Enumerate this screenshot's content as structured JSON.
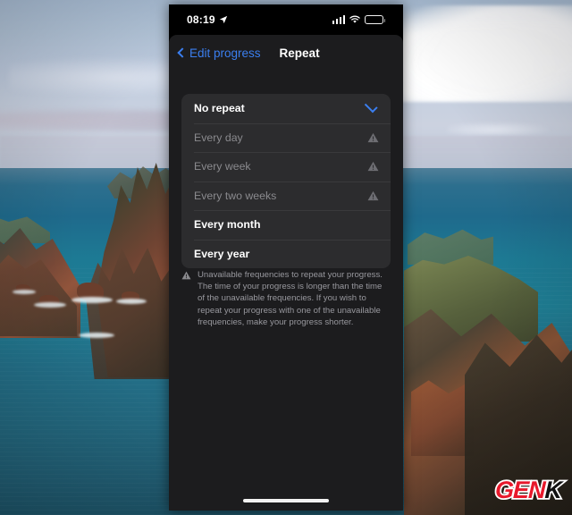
{
  "background": {
    "description": "coastal cliffs and ocean landscape photo",
    "sky_color": "#bdcade",
    "sea_color": "#1f7f95",
    "cliff_color": "#8b4f38"
  },
  "watermark": {
    "part1": "GEN",
    "part2": "K",
    "color1": "#e8192c",
    "color2": "#111111"
  },
  "phone": {
    "status_bar": {
      "time": "08:19",
      "location_icon": "location-arrow-icon",
      "cellular_icon": "signal-bars-icon",
      "wifi_icon": "wifi-icon",
      "battery_icon": "battery-icon"
    },
    "nav_bar": {
      "back_label": "Edit progress",
      "back_icon": "chevron-left-icon",
      "title": "Repeat"
    },
    "options": [
      {
        "label": "No repeat",
        "state": "selected",
        "accessory": "checkmark-icon"
      },
      {
        "label": "Every day",
        "state": "disabled",
        "accessory": "warning-triangle-icon"
      },
      {
        "label": "Every week",
        "state": "disabled",
        "accessory": "warning-triangle-icon"
      },
      {
        "label": "Every two weeks",
        "state": "disabled",
        "accessory": "warning-triangle-icon"
      },
      {
        "label": "Every month",
        "state": "enabled",
        "accessory": "none"
      },
      {
        "label": "Every year",
        "state": "enabled",
        "accessory": "none"
      }
    ],
    "footer_note": {
      "icon": "warning-triangle-icon",
      "text": "Unavailable frequencies to repeat your progress. The time of your progress is longer than the time of the unavailable frequencies. If you wish to repeat your progress with one of the unavailable frequencies, make your progress shorter."
    },
    "home_indicator": "home-indicator",
    "accent_color": "#3b7ff0",
    "card_background": "#2c2c2e",
    "screen_background": "#1c1c1e"
  }
}
